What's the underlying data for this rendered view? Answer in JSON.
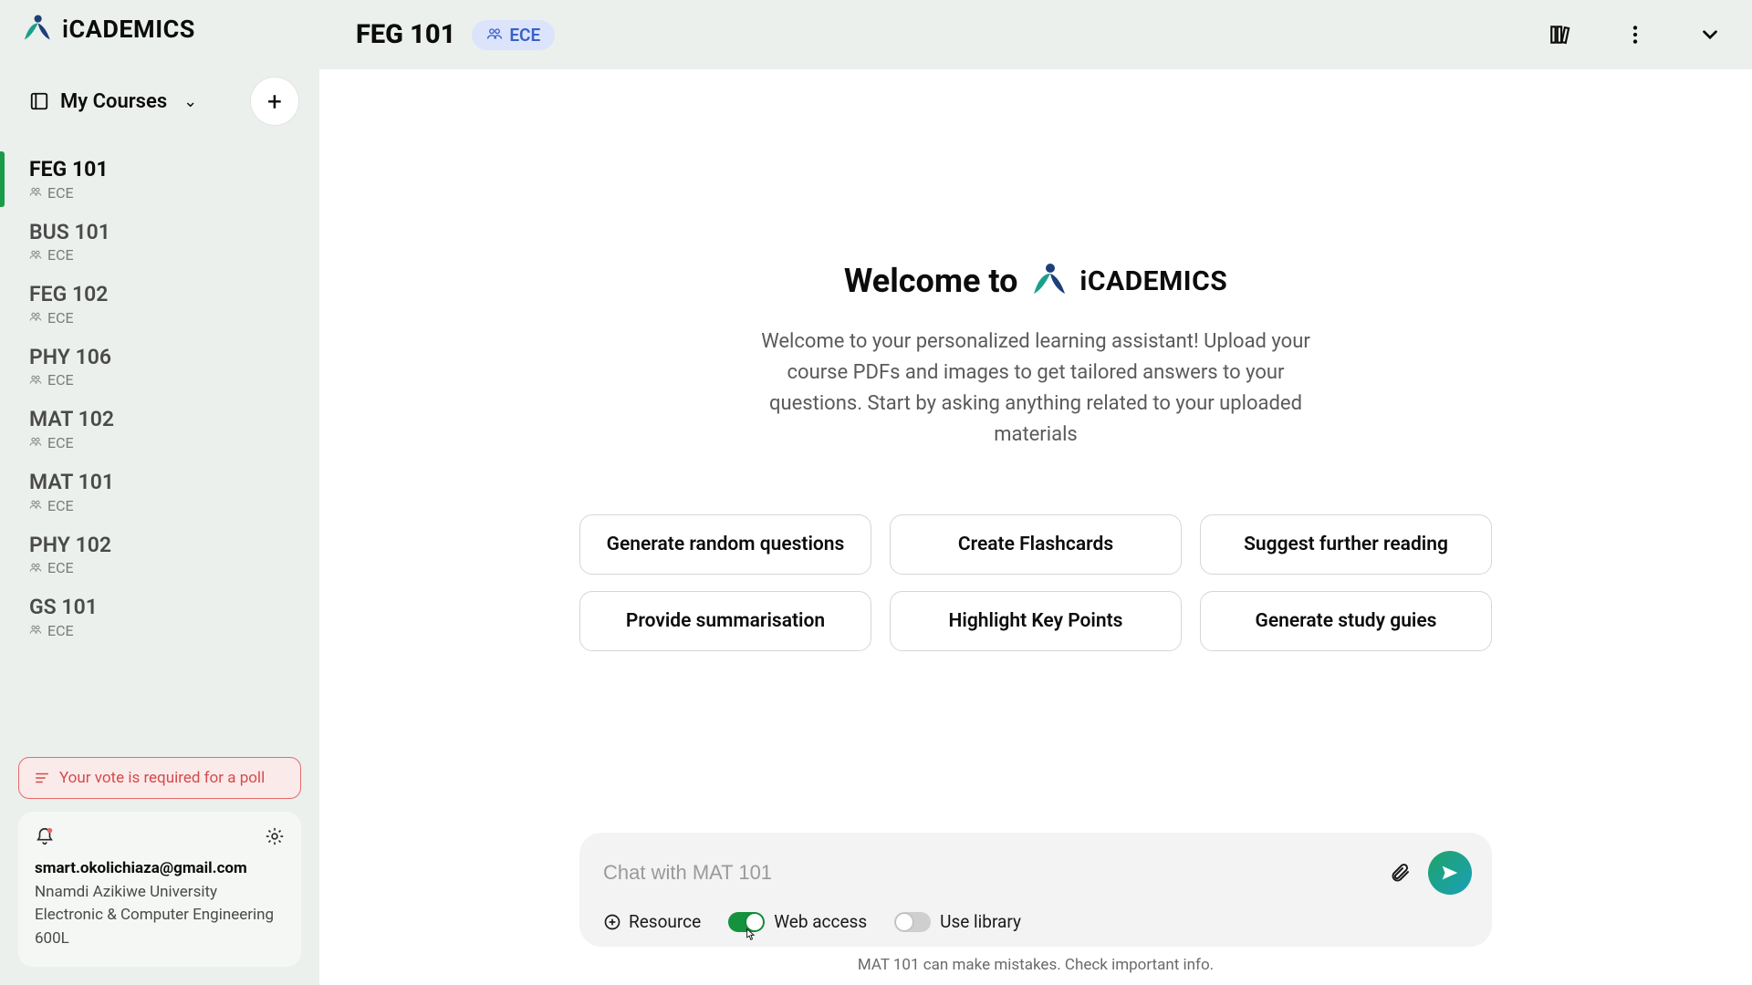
{
  "brand": {
    "name_i": "i",
    "name_rest": "CADEMICS"
  },
  "sidebar": {
    "my_courses_label": "My Courses",
    "courses": [
      {
        "code": "FEG 101",
        "dept": "ECE",
        "active": true
      },
      {
        "code": "BUS 101",
        "dept": "ECE",
        "active": false
      },
      {
        "code": "FEG 102",
        "dept": "ECE",
        "active": false
      },
      {
        "code": "PHY 106",
        "dept": "ECE",
        "active": false
      },
      {
        "code": "MAT 102",
        "dept": "ECE",
        "active": false
      },
      {
        "code": "MAT 101",
        "dept": "ECE",
        "active": false
      },
      {
        "code": "PHY 102",
        "dept": "ECE",
        "active": false
      },
      {
        "code": "GS 101",
        "dept": "ECE",
        "active": false
      }
    ],
    "alert_text": "Your vote is required for a poll",
    "user": {
      "email": "smart.okolichiaza@gmail.com",
      "university": "Nnamdi Azikiwe University",
      "program": "Electronic & Computer Engineering",
      "level": "600L"
    }
  },
  "header": {
    "course_code": "FEG 101",
    "dept_badge": "ECE"
  },
  "welcome": {
    "prefix": "Welcome to",
    "description": "Welcome to your personalized learning assistant! Upload your course PDFs and images to get tailored answers to your questions. Start by asking anything related to your uploaded materials"
  },
  "suggestions": [
    "Generate random questions",
    "Create Flashcards",
    "Suggest further reading",
    "Provide summarisation",
    "Highlight Key Points",
    "Generate study guies"
  ],
  "chat": {
    "placeholder": "Chat with MAT 101",
    "resource_label": "Resource",
    "web_access_label": "Web access",
    "web_access_on": true,
    "use_library_label": "Use library",
    "use_library_on": false,
    "disclaimer": "MAT 101 can make mistakes. Check important info."
  }
}
